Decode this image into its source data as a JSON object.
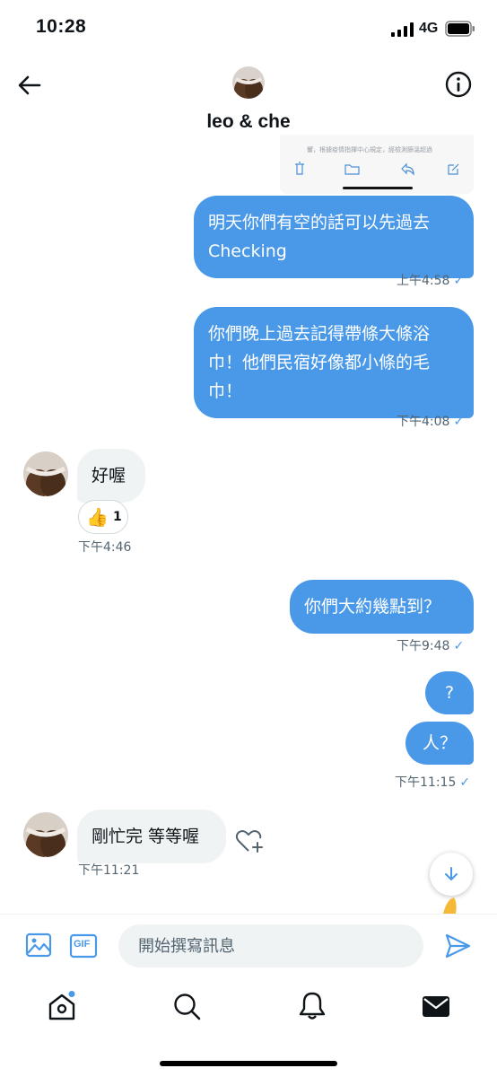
{
  "status_bar": {
    "time": "10:28",
    "network": "4G"
  },
  "header": {
    "title": "leo & che",
    "back_icon": "arrow-left-icon",
    "info_icon": "info-icon"
  },
  "shared_image": {
    "visible_text": "響，根據疫情指揮中心規定，經檢測篩溫超過"
  },
  "messages": [
    {
      "direction": "out",
      "lines": [
        "明天你們有空的話可以先過去",
        "Checking"
      ],
      "time": "上午4:58",
      "read": true
    },
    {
      "direction": "out",
      "lines": [
        "你們晚上過去記得帶條大條浴",
        "巾！他們民宿好像都小條的毛",
        "巾！"
      ],
      "time": "下午4:08",
      "read": true
    },
    {
      "direction": "in",
      "lines": [
        "好喔"
      ],
      "time": "下午4:46",
      "reaction": {
        "emoji": "👍",
        "count": "1"
      }
    },
    {
      "direction": "out",
      "lines": [
        "你們大約幾點到？"
      ],
      "time": "下午9:48",
      "read": true
    },
    {
      "direction": "out",
      "lines": [
        "?"
      ]
    },
    {
      "direction": "out",
      "lines": [
        "人？"
      ],
      "time": "下午11:15",
      "read": true
    },
    {
      "direction": "in",
      "lines": [
        "剛忙完 等等喔"
      ],
      "time": "下午11:21"
    }
  ],
  "read_mark": "✓",
  "composer": {
    "placeholder": "開始撰寫訊息",
    "gif_label": "GIF"
  },
  "tabs": [
    "home-icon",
    "search-icon",
    "notifications-icon",
    "messages-icon"
  ],
  "colors": {
    "accent": "#4a99e9",
    "incoming_bubble": "#eff3f4",
    "secondary_text": "#536471"
  }
}
